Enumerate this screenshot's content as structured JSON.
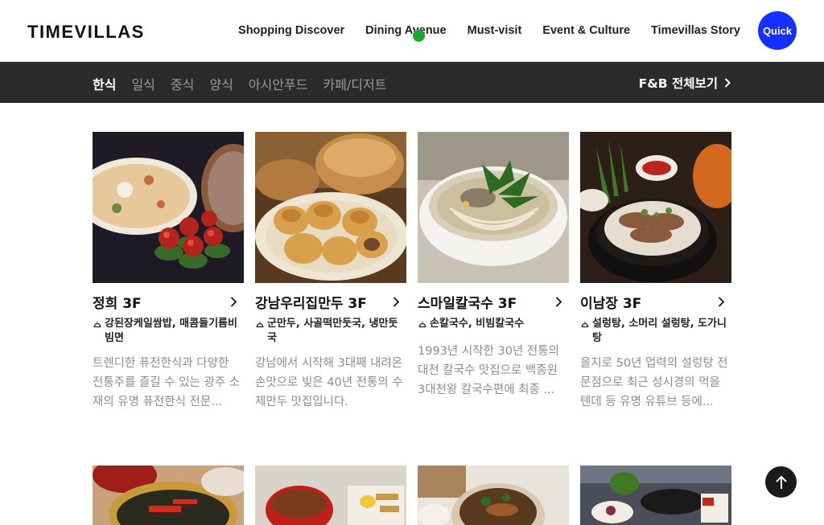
{
  "header": {
    "logo": "TIMEVILLAS",
    "nav": [
      "Shopping Discover",
      "Dining Avenue",
      "Must-visit",
      "Event & Culture",
      "Timevillas Story"
    ],
    "quick_label": "Quick"
  },
  "categories": {
    "items": [
      "한식",
      "일식",
      "중식",
      "양식",
      "아시안푸드",
      "카페/디저트"
    ],
    "active_index": 0,
    "all_view_label": "F&B 전체보기"
  },
  "cards": [
    {
      "title": "정희 3F",
      "menu": "강된장케일쌈밥, 매콤들기름비빔면",
      "desc": "트렌디한 퓨전한식과 다양한 전통주를 즐길 수 있는 광주 소재의 유명 퓨전한식 전문...",
      "image": "plated fusion dish with red glazed balls on greens"
    },
    {
      "title": "강남우리집만두 3F",
      "menu": "군만두, 사골떡만둣국, 냉만둣국",
      "desc": "강남에서 시작해 3대째 내려온 손맛으로 빚은 40년 전통의 수제만두 맛집입니다.",
      "image": "fried dumplings with bamboo steamer"
    },
    {
      "title": "스마일칼국수 3F",
      "menu": "손칼국수, 비빔칼국수",
      "desc": "1993년 시작한 30년 전통의 대전 칼국수 맛집으로 백종원 3대천왕 칼국수편에 최종 ...",
      "image": "knife-cut noodle soup with greens"
    },
    {
      "title": "이남장 3F",
      "menu": "설렁탕, 소머리 설렁탕, 도가니탕",
      "desc": "을지로 50년 업력의 설렁탕 전문점으로 최근 성시경의 먹을텐데 등 유명 유튜브 등에...",
      "image": "beef bone soup with side dishes"
    }
  ],
  "colors": {
    "quick_bg": "#1230ff",
    "catbar_bg": "#2b2b2b",
    "cursor_dot": "#18a82a"
  }
}
